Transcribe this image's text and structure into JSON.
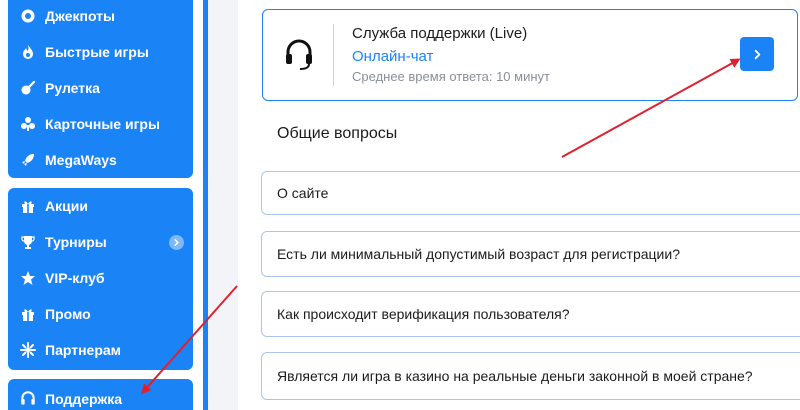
{
  "sidebar": {
    "group1": [
      {
        "label": "Джекпоты",
        "icon": "jackpot-icon"
      },
      {
        "label": "Быстрые игры",
        "icon": "flame-icon"
      },
      {
        "label": "Рулетка",
        "icon": "roulette-icon"
      },
      {
        "label": "Карточные игры",
        "icon": "cards-icon"
      },
      {
        "label": "MegaWays",
        "icon": "rocket-icon"
      }
    ],
    "group2": [
      {
        "label": "Акции",
        "icon": "gift-icon"
      },
      {
        "label": "Турниры",
        "icon": "trophy-icon"
      },
      {
        "label": "VIP-клуб",
        "icon": "star-icon"
      },
      {
        "label": "Промо",
        "icon": "promo-gift-icon"
      },
      {
        "label": "Партнерам",
        "icon": "partners-icon"
      }
    ],
    "support": {
      "label": "Поддержка",
      "icon": "headset-icon"
    }
  },
  "support_card": {
    "title": "Служба поддержки (Live)",
    "link": "Онлайн-чат",
    "subtitle": "Среднее время ответа: 10 минут",
    "icon": "headset-icon",
    "button_icon": "chevron-right-icon"
  },
  "faq": {
    "title": "Общие вопросы",
    "items": [
      "О сайте",
      "Есть ли минимальный допустимый возраст для регистрации?",
      "Как происходит верификация пользователя?",
      "Является ли игра в казино на реальные деньги законной в моей стране?"
    ]
  },
  "colors": {
    "accent": "#1a84f7",
    "annotation_arrow": "#e0202f",
    "border": "#a9c6ea",
    "muted_text": "#8a8f99"
  }
}
